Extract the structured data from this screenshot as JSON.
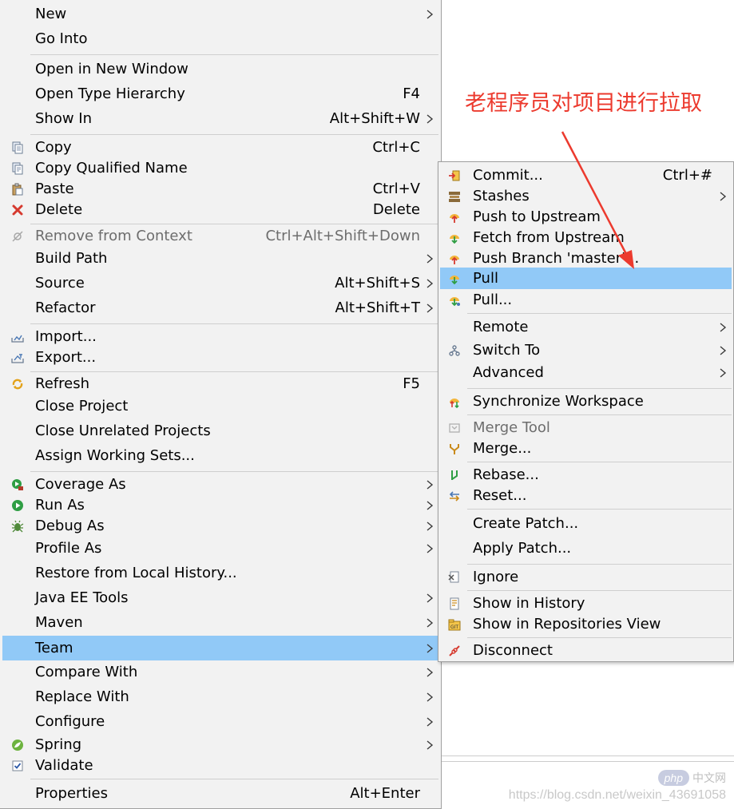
{
  "main_menu": {
    "items": [
      {
        "label": "New",
        "shortcut": "",
        "submenu": true
      },
      {
        "label": "Go Into",
        "shortcut": "",
        "submenu": false
      },
      {
        "label": "Open in New Window",
        "shortcut": "",
        "submenu": false
      },
      {
        "label": "Open Type Hierarchy",
        "shortcut": "F4",
        "submenu": false
      },
      {
        "label": "Show In",
        "shortcut": "Alt+Shift+W",
        "submenu": true
      },
      {
        "label": "Copy",
        "shortcut": "Ctrl+C",
        "submenu": false,
        "icon": "copy-icon"
      },
      {
        "label": "Copy Qualified Name",
        "shortcut": "",
        "submenu": false,
        "icon": "copy-qualified-name-icon"
      },
      {
        "label": "Paste",
        "shortcut": "Ctrl+V",
        "submenu": false,
        "icon": "paste-icon"
      },
      {
        "label": "Delete",
        "shortcut": "Delete",
        "submenu": false,
        "icon": "delete-icon"
      },
      {
        "label": "Remove from Context",
        "shortcut": "Ctrl+Alt+Shift+Down",
        "submenu": false,
        "icon": "remove-from-context-icon",
        "disabled": true
      },
      {
        "label": "Build Path",
        "shortcut": "",
        "submenu": true
      },
      {
        "label": "Source",
        "shortcut": "Alt+Shift+S",
        "submenu": true
      },
      {
        "label": "Refactor",
        "shortcut": "Alt+Shift+T",
        "submenu": true
      },
      {
        "label": "Import...",
        "shortcut": "",
        "submenu": false,
        "icon": "import-icon"
      },
      {
        "label": "Export...",
        "shortcut": "",
        "submenu": false,
        "icon": "export-icon"
      },
      {
        "label": "Refresh",
        "shortcut": "F5",
        "submenu": false,
        "icon": "refresh-icon"
      },
      {
        "label": "Close Project",
        "shortcut": "",
        "submenu": false
      },
      {
        "label": "Close Unrelated Projects",
        "shortcut": "",
        "submenu": false
      },
      {
        "label": "Assign Working Sets...",
        "shortcut": "",
        "submenu": false
      },
      {
        "label": "Coverage As",
        "shortcut": "",
        "submenu": true,
        "icon": "coverage-icon"
      },
      {
        "label": "Run As",
        "shortcut": "",
        "submenu": true,
        "icon": "run-icon"
      },
      {
        "label": "Debug As",
        "shortcut": "",
        "submenu": true,
        "icon": "debug-icon"
      },
      {
        "label": "Profile As",
        "shortcut": "",
        "submenu": true
      },
      {
        "label": "Restore from Local History...",
        "shortcut": "",
        "submenu": false
      },
      {
        "label": "Java EE Tools",
        "shortcut": "",
        "submenu": true
      },
      {
        "label": "Maven",
        "shortcut": "",
        "submenu": true
      },
      {
        "label": "Team",
        "shortcut": "",
        "submenu": true,
        "highlighted": true
      },
      {
        "label": "Compare With",
        "shortcut": "",
        "submenu": true
      },
      {
        "label": "Replace With",
        "shortcut": "",
        "submenu": true
      },
      {
        "label": "Configure",
        "shortcut": "",
        "submenu": true
      },
      {
        "label": "Spring",
        "shortcut": "",
        "submenu": true,
        "icon": "spring-icon"
      },
      {
        "label": "Validate",
        "shortcut": "",
        "submenu": false,
        "icon": "validate-icon"
      },
      {
        "label": "Properties",
        "shortcut": "Alt+Enter",
        "submenu": false
      }
    ]
  },
  "team_submenu": {
    "items": [
      {
        "label": "Commit...",
        "shortcut": "Ctrl+#",
        "submenu": false,
        "icon": "commit-icon"
      },
      {
        "label": "Stashes",
        "shortcut": "",
        "submenu": true,
        "icon": "stashes-icon"
      },
      {
        "label": "Push to Upstream",
        "shortcut": "",
        "submenu": false,
        "icon": "push-icon"
      },
      {
        "label": "Fetch from Upstream",
        "shortcut": "",
        "submenu": false,
        "icon": "fetch-icon"
      },
      {
        "label": "Push Branch 'master'...",
        "shortcut": "",
        "submenu": false,
        "icon": "push-branch-icon"
      },
      {
        "label": "Pull",
        "shortcut": "",
        "submenu": false,
        "icon": "pull-icon",
        "highlighted": true
      },
      {
        "label": "Pull...",
        "shortcut": "",
        "submenu": false,
        "icon": "pull-dialog-icon"
      },
      {
        "label": "Remote",
        "shortcut": "",
        "submenu": true
      },
      {
        "label": "Switch To",
        "shortcut": "",
        "submenu": true,
        "icon": "switch-to-icon"
      },
      {
        "label": "Advanced",
        "shortcut": "",
        "submenu": true
      },
      {
        "label": "Synchronize Workspace",
        "shortcut": "",
        "submenu": false,
        "icon": "synchronize-icon"
      },
      {
        "label": "Merge Tool",
        "shortcut": "",
        "submenu": false,
        "icon": "merge-tool-icon",
        "disabled": true
      },
      {
        "label": "Merge...",
        "shortcut": "",
        "submenu": false,
        "icon": "merge-icon"
      },
      {
        "label": "Rebase...",
        "shortcut": "",
        "submenu": false,
        "icon": "rebase-icon"
      },
      {
        "label": "Reset...",
        "shortcut": "",
        "submenu": false,
        "icon": "reset-icon"
      },
      {
        "label": "Create Patch...",
        "shortcut": "",
        "submenu": false
      },
      {
        "label": "Apply Patch...",
        "shortcut": "",
        "submenu": false
      },
      {
        "label": "Ignore",
        "shortcut": "",
        "submenu": false,
        "icon": "ignore-icon"
      },
      {
        "label": "Show in History",
        "shortcut": "",
        "submenu": false,
        "icon": "history-icon"
      },
      {
        "label": "Show in Repositories View",
        "shortcut": "",
        "submenu": false,
        "icon": "repositories-icon"
      },
      {
        "label": "Disconnect",
        "shortcut": "",
        "submenu": false,
        "icon": "disconnect-icon"
      }
    ]
  },
  "annotation": {
    "text": "老程序员对项目进行拉取",
    "color": "#ec3a2e"
  },
  "watermark": {
    "badge": "php",
    "site": "中文网",
    "url": "https://blog.csdn.net/weixin_43691058"
  },
  "colors": {
    "menu_background": "#f2f2f2",
    "highlight": "#91c9f7",
    "disabled_text": "#6d6d6d"
  }
}
